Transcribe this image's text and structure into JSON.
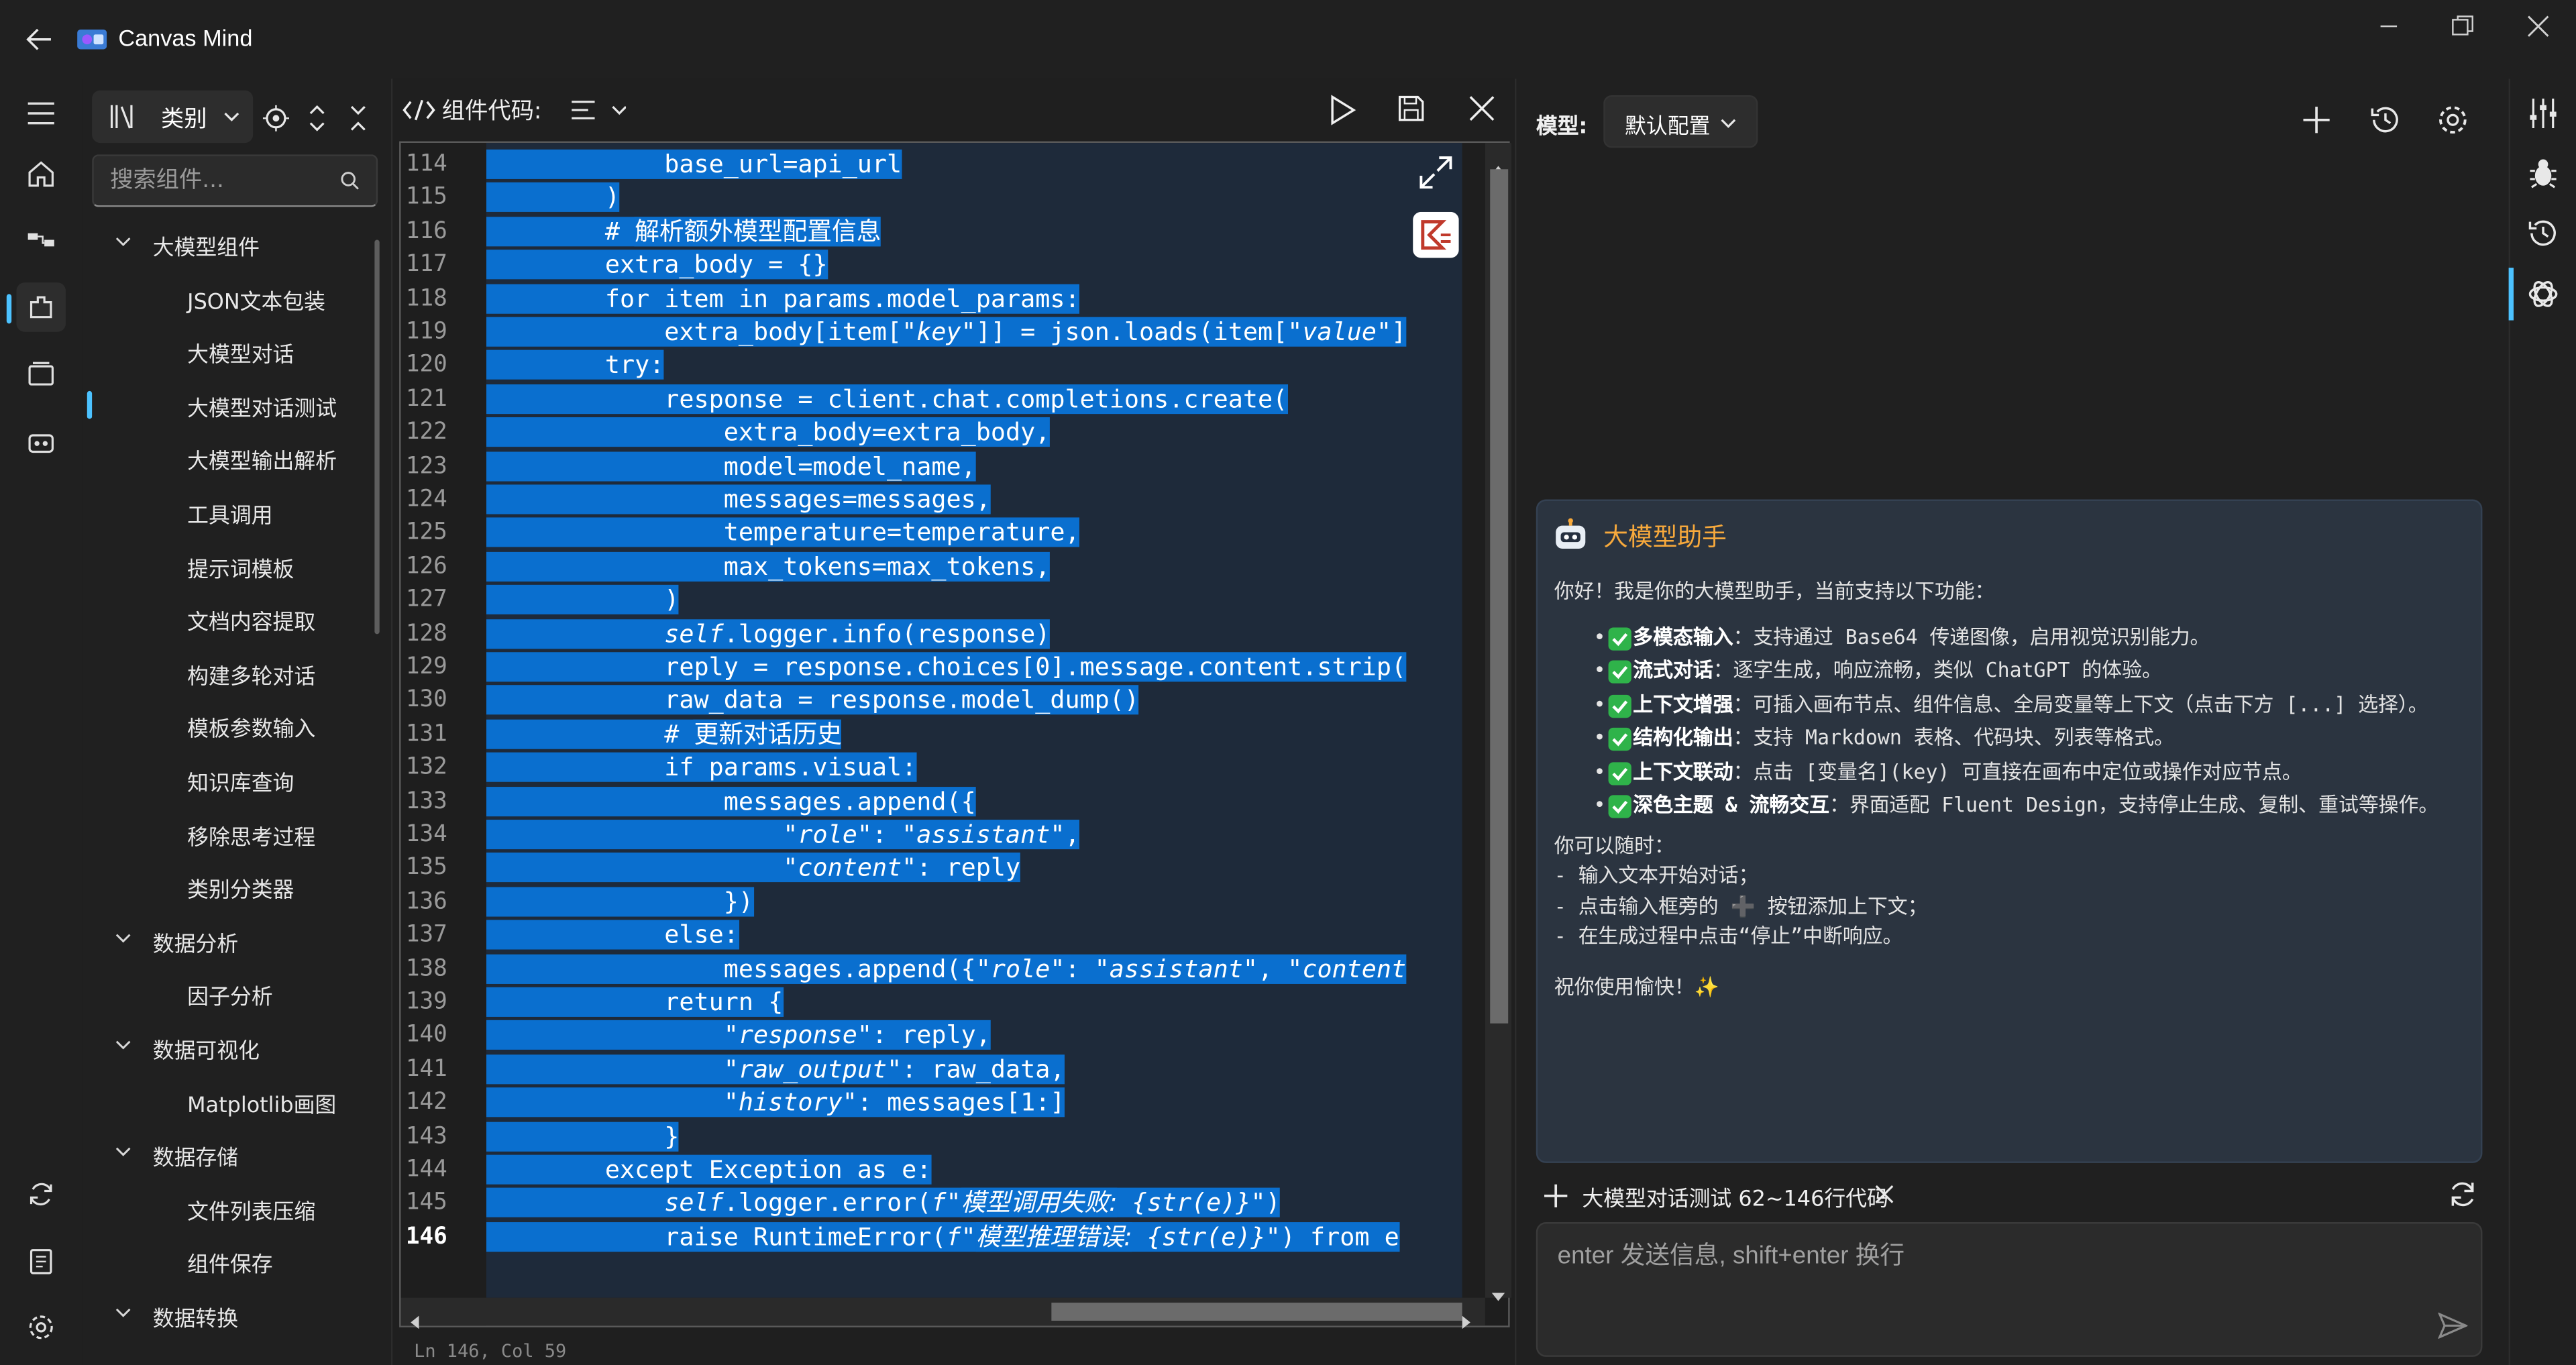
{
  "app": {
    "title": "Canvas Mind"
  },
  "components": {
    "category_label": "类别",
    "search_placeholder": "搜索组件...",
    "tree": [
      {
        "kind": "group",
        "label": "大模型组件"
      },
      {
        "kind": "child",
        "label": "JSON文本包装"
      },
      {
        "kind": "child",
        "label": "大模型对话"
      },
      {
        "kind": "child",
        "label": "大模型对话测试",
        "selected": true
      },
      {
        "kind": "child",
        "label": "大模型输出解析"
      },
      {
        "kind": "child",
        "label": "工具调用"
      },
      {
        "kind": "child",
        "label": "提示词模板"
      },
      {
        "kind": "child",
        "label": "文档内容提取"
      },
      {
        "kind": "child",
        "label": "构建多轮对话"
      },
      {
        "kind": "child",
        "label": "模板参数输入"
      },
      {
        "kind": "child",
        "label": "知识库查询"
      },
      {
        "kind": "child",
        "label": "移除思考过程"
      },
      {
        "kind": "child",
        "label": "类别分类器"
      },
      {
        "kind": "group",
        "label": "数据分析"
      },
      {
        "kind": "child",
        "label": "因子分析"
      },
      {
        "kind": "group",
        "label": "数据可视化"
      },
      {
        "kind": "child",
        "label": "Matplotlib画图"
      },
      {
        "kind": "group",
        "label": "数据存储"
      },
      {
        "kind": "child",
        "label": "文件列表压缩"
      },
      {
        "kind": "child",
        "label": "组件保存"
      },
      {
        "kind": "group",
        "label": "数据转换"
      }
    ]
  },
  "editor": {
    "toolbar_label": "组件代码:",
    "status": "Ln 146, Col 59",
    "current_line": 146,
    "lines": [
      {
        "n": 114,
        "html": "            base_url=api_url"
      },
      {
        "n": 115,
        "html": "        )"
      },
      {
        "n": 116,
        "html": "        # <span class='cmt'>解析额外模型配置信息</span>"
      },
      {
        "n": 117,
        "html": "        extra_body = {}"
      },
      {
        "n": 118,
        "html": "        for item in params.model_params:"
      },
      {
        "n": 119,
        "html": "            extra_body[item[<i>\"key\"</i>]] = json.loads(item[<i>\"value\"</i>]"
      },
      {
        "n": 120,
        "html": "        try:"
      },
      {
        "n": 121,
        "html": "            response = client.chat.completions.create("
      },
      {
        "n": 122,
        "html": "                extra_body=extra_body,"
      },
      {
        "n": 123,
        "html": "                model=model_name,"
      },
      {
        "n": 124,
        "html": "                messages=messages,"
      },
      {
        "n": 125,
        "html": "                temperature=temperature,"
      },
      {
        "n": 126,
        "html": "                max_tokens=max_tokens,"
      },
      {
        "n": 127,
        "html": "            )"
      },
      {
        "n": 128,
        "html": "            <i>self</i>.logger.info(response)"
      },
      {
        "n": 129,
        "html": "            reply = response.choices[0].message.content.strip("
      },
      {
        "n": 130,
        "html": "            raw_data = response.model_dump()"
      },
      {
        "n": 131,
        "html": "            # <span class='cmt'>更新对话历史</span>"
      },
      {
        "n": 132,
        "html": "            if params.visual:"
      },
      {
        "n": 133,
        "html": "                messages.append({"
      },
      {
        "n": 134,
        "html": "                    <i>\"role\"</i>: <i>\"assistant\"</i>,"
      },
      {
        "n": 135,
        "html": "                    <i>\"content\"</i>: reply"
      },
      {
        "n": 136,
        "html": "                })"
      },
      {
        "n": 137,
        "html": "            else:"
      },
      {
        "n": 138,
        "html": "                messages.append({<i>\"role\"</i>: <i>\"assistant\"</i>, <i>\"content</i>"
      },
      {
        "n": 139,
        "html": "            return {"
      },
      {
        "n": 140,
        "html": "                <i>\"response\"</i>: reply,"
      },
      {
        "n": 141,
        "html": "                <i>\"raw_output\"</i>: raw_data,"
      },
      {
        "n": 142,
        "html": "                <i>\"history\"</i>: messages[1:]"
      },
      {
        "n": 143,
        "html": "            }"
      },
      {
        "n": 144,
        "html": "        except Exception as e:"
      },
      {
        "n": 145,
        "html": "            <i>self</i>.logger.error(<i>f\"<span class='cmt'>模型调用失败:</span> {str(e)}\"</i>)"
      },
      {
        "n": 146,
        "html": "            raise RuntimeError(<i>f\"<span class='cmt'>模型推理错误:</span> {str(e)}\"</i>) from e"
      }
    ]
  },
  "chat": {
    "model_label": "模型:",
    "model_value": "默认配置",
    "assistant_name": "大模型助手",
    "greeting": "你好！我是你的大模型助手，当前支持以下功能：",
    "features": [
      {
        "bold": "多模态输入",
        "text": "：支持通过 Base64 传递图像，启用视觉识别能力。"
      },
      {
        "bold": "流式对话",
        "text": "：逐字生成，响应流畅，类似 ChatGPT 的体验。"
      },
      {
        "bold": "上下文增强",
        "text": "：可插入画布节点、组件信息、全局变量等上下文（点击下方 [...] 选择）。"
      },
      {
        "bold": "结构化输出",
        "text": "：支持 Markdown 表格、代码块、列表等格式。"
      },
      {
        "bold": "上下文联动",
        "text": "：点击 [变量名](key) 可直接在画布中定位或操作对应节点。"
      },
      {
        "bold": "深色主题 & 流畅交互",
        "text": "：界面适配 Fluent Design，支持停止生成、复制、重试等操作。"
      }
    ],
    "can_do": "你可以随时：",
    "tips": [
      "- 输入文本开始对话；",
      "- 点击输入框旁的 ➕ 按钮添加上下文；",
      "- 在生成过程中点击“停止”中断响应。"
    ],
    "wish": "祝你使用愉快！✨",
    "context_chip": "大模型对话测试 62~146行代码",
    "input_placeholder": "enter 发送信息, shift+enter 换行"
  },
  "colors": {
    "accent": "#4cc2ff",
    "selection": "#0a6fcf",
    "assistant_title": "#f7a93c",
    "check": "#2fb34a"
  }
}
